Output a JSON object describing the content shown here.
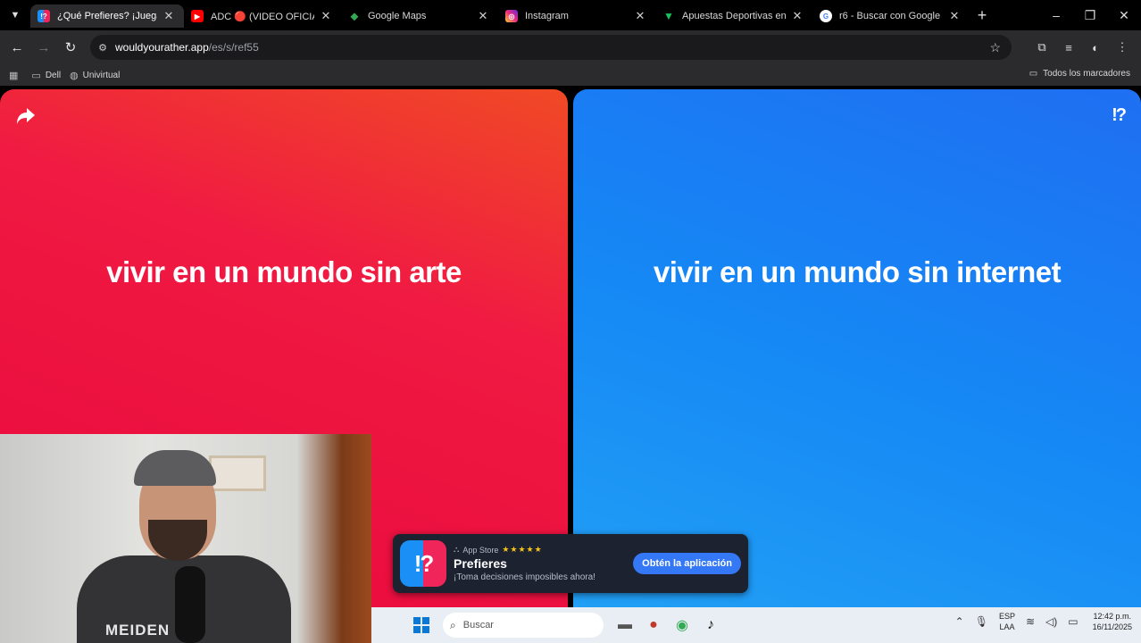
{
  "browser": {
    "tabs": [
      {
        "title": "¿Qué Prefieres? ¡Juega en l",
        "active": true,
        "favicon": "wouldyourather-icon",
        "color": "#1a8ff5"
      },
      {
        "title": "ADC 🔴 (VIDEO OFICIAL) |",
        "active": false,
        "favicon": "youtube-icon",
        "color": "#ff0000"
      },
      {
        "title": "Google Maps",
        "active": false,
        "favicon": "maps-icon",
        "color": "#34a853"
      },
      {
        "title": "Instagram",
        "active": false,
        "favicon": "instagram-icon",
        "color": "#d62976"
      },
      {
        "title": "Apuestas Deportivas en Vi",
        "active": false,
        "favicon": "betting-icon",
        "color": "#19c25a"
      },
      {
        "title": "r6 - Buscar con Google",
        "active": false,
        "favicon": "google-icon",
        "color": "#4285f4"
      }
    ],
    "url_host": "wouldyourather.app",
    "url_path": "/es/s/ref55",
    "bookmarks": [
      {
        "label": "Dell"
      },
      {
        "label": "Univirtual"
      }
    ],
    "all_bookmarks_label": "Todos los marcadores"
  },
  "game": {
    "option_a": "vivir en un mundo sin arte",
    "option_b": "vivir en un mundo sin internet",
    "logo": "!?",
    "colors": {
      "red": "#f01a42",
      "blue": "#1588f5"
    }
  },
  "webcam": {
    "shirt_text": "MEIDEN"
  },
  "app_banner": {
    "store": "App Store",
    "stars": "★★★★★",
    "icon_text": "!?",
    "name": "Prefieres",
    "tagline": "¡Toma decisiones imposibles ahora!",
    "cta": "Obtén la aplicación"
  },
  "taskbar": {
    "search_placeholder": "Buscar",
    "lang_top": "ESP",
    "lang_bottom": "LAA",
    "time": "12:42 p.m.",
    "date": "16/11/2025"
  }
}
